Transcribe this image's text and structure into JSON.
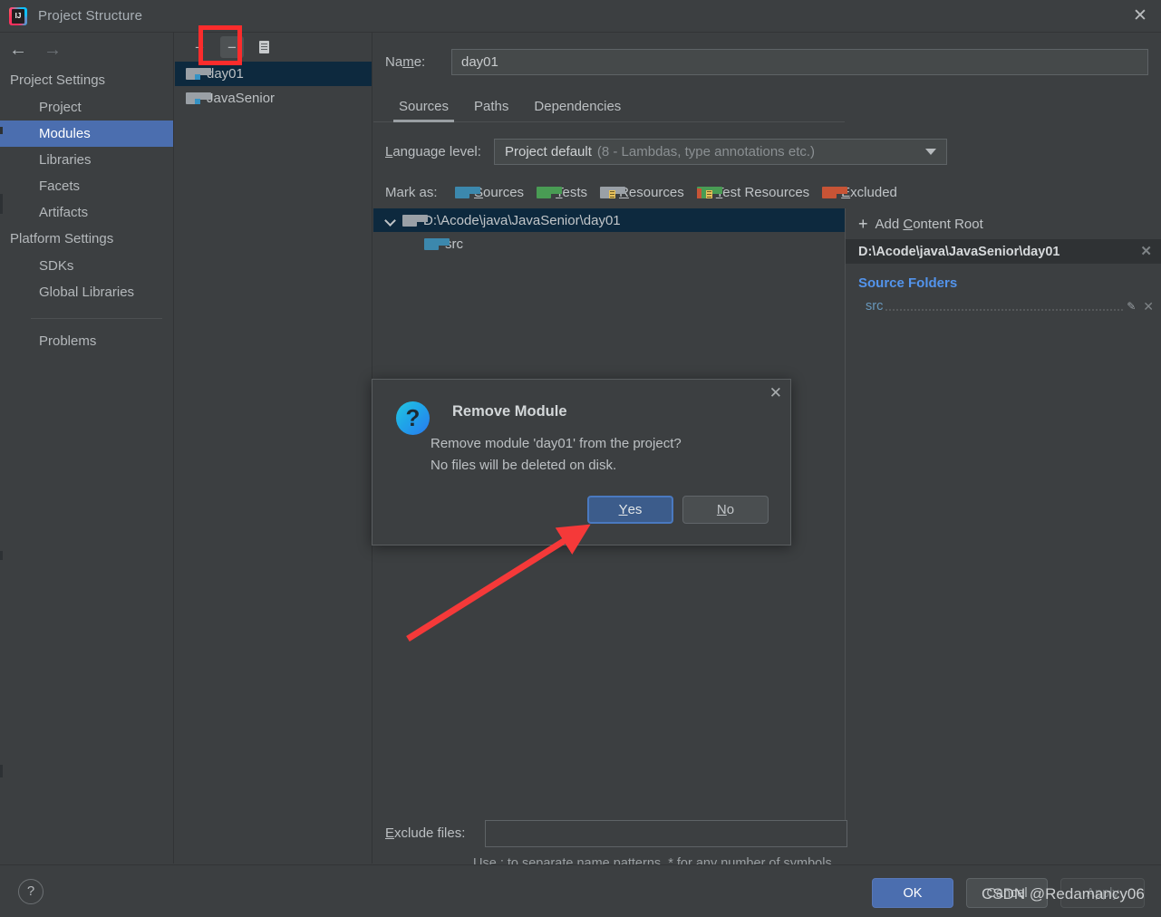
{
  "window": {
    "title": "Project Structure",
    "logo_icon": "intellij-idea-logo",
    "close_icon": "close-icon"
  },
  "nav": {
    "back_icon": "arrow-left-icon",
    "forward_icon": "arrow-right-icon"
  },
  "sidebar": {
    "groups": [
      {
        "label": "Project Settings",
        "items": [
          {
            "label": "Project",
            "selected": false
          },
          {
            "label": "Modules",
            "selected": true
          },
          {
            "label": "Libraries",
            "selected": false
          },
          {
            "label": "Facets",
            "selected": false
          },
          {
            "label": "Artifacts",
            "selected": false
          }
        ]
      },
      {
        "label": "Platform Settings",
        "items": [
          {
            "label": "SDKs",
            "selected": false
          },
          {
            "label": "Global Libraries",
            "selected": false
          }
        ]
      }
    ],
    "problems_label": "Problems"
  },
  "module_panel": {
    "toolbar": {
      "add_icon": "plus-icon",
      "remove_icon": "minus-icon",
      "copy_icon": "copy-icon"
    },
    "modules": [
      {
        "label": "day01",
        "selected": true
      },
      {
        "label": "JavaSenior",
        "selected": false
      }
    ]
  },
  "main": {
    "name_label_pre": "Na",
    "name_label_accel": "m",
    "name_label_post": "e:",
    "name_value": "day01",
    "tabs": [
      {
        "label": "Sources",
        "active": true
      },
      {
        "label": "Paths",
        "active": false
      },
      {
        "label": "Dependencies",
        "active": false
      }
    ],
    "language_level": {
      "label_accel": "L",
      "label_rest": "anguage level:",
      "value_main": "Project default",
      "value_sub": "(8 - Lambdas, type annotations etc.)",
      "caret_icon": "chevron-down-icon"
    },
    "mark_as": {
      "label": "Mark as:",
      "options": [
        {
          "accel": "S",
          "rest": "ources",
          "color": "#3c88ad",
          "kind": "plain"
        },
        {
          "accel": "T",
          "rest": "ests",
          "color": "#499c54",
          "kind": "plain"
        },
        {
          "accel": "R",
          "rest": "esources",
          "color": "#9aa0a6",
          "kind": "lined"
        },
        {
          "accel": "T",
          "rest": "est Resources",
          "color": "#499c54",
          "kind": "lined-split"
        },
        {
          "accel": "E",
          "rest": "xcluded",
          "color": "#c75436",
          "kind": "plain"
        }
      ]
    },
    "tree": {
      "root": {
        "label": "D:\\Acode\\java\\JavaSenior\\day01",
        "expand_icon": "chevron-down-icon",
        "folder_icon": "folder-icon",
        "selected": true
      },
      "children": [
        {
          "label": "src",
          "folder_icon": "folder-sources-icon"
        }
      ]
    },
    "right_panel": {
      "add_content_root_pre": "Add ",
      "add_content_root_accel": "C",
      "add_content_root_post": "ontent Root",
      "add_icon": "plus-icon",
      "root_path": "D:\\Acode\\java\\JavaSenior\\day01",
      "root_remove_icon": "close-icon",
      "source_folders_header": "Source Folders",
      "source_folders": [
        {
          "label": "src",
          "edit_icon": "pencil-icon",
          "remove_icon": "close-icon"
        }
      ]
    },
    "exclude": {
      "label_accel": "E",
      "label_rest": "xclude files:",
      "value": "",
      "hint": "Use ; to separate name patterns, * for any number of symbols, ? for one."
    }
  },
  "footer": {
    "help_icon": "help-icon",
    "ok_label": "OK",
    "cancel_label": "Cancel",
    "apply_label": "Apply"
  },
  "dialog": {
    "icon": "question-mark-icon",
    "icon_glyph": "?",
    "title": "Remove Module",
    "message_line1": "Remove module 'day01' from the project?",
    "message_line2": "No files will be deleted on disk.",
    "close_icon": "close-icon",
    "yes_accel": "Y",
    "yes_rest": "es",
    "no_accel": "N",
    "no_rest": "o"
  },
  "annotations": {
    "highlight_box_color": "#fb2c2c",
    "arrow_color": "#f53939",
    "watermark": "CSDN @Redamancy06"
  }
}
